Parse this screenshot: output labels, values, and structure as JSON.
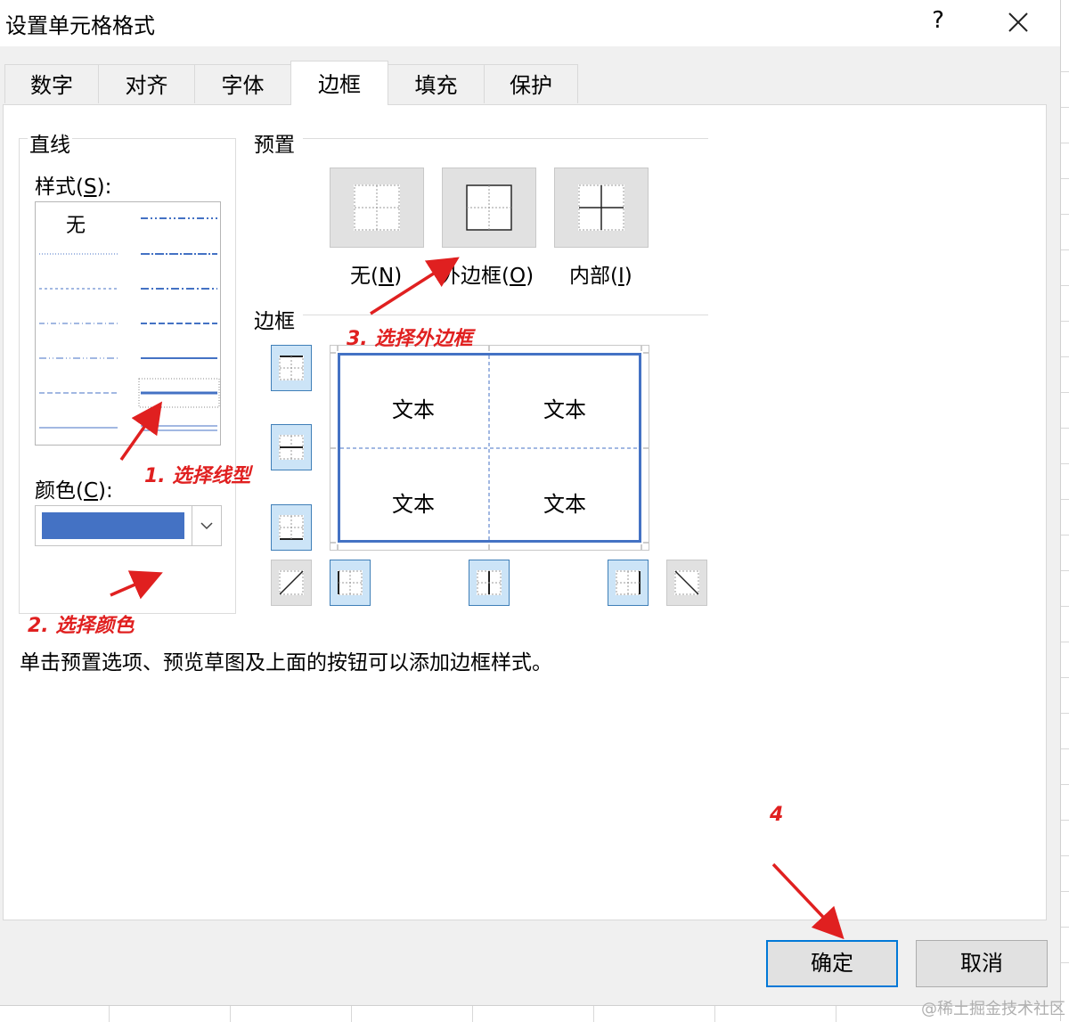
{
  "window": {
    "title": "设置单元格格式",
    "help_label": "?"
  },
  "tabs": [
    {
      "label": "数字"
    },
    {
      "label": "对齐"
    },
    {
      "label": "字体"
    },
    {
      "label": "边框",
      "active": true
    },
    {
      "label": "填充"
    },
    {
      "label": "保护"
    }
  ],
  "line_group": {
    "title": "直线",
    "style_label": "样式(",
    "style_key": "S",
    "style_suffix": "):",
    "none_option": "无",
    "color_label": "颜色(",
    "color_key": "C",
    "color_suffix": "):",
    "selected_color": "#4472c4"
  },
  "presets": {
    "title": "预置",
    "items": [
      {
        "label": "无(",
        "key": "N",
        "suffix": ")"
      },
      {
        "label": "外边框(",
        "key": "O",
        "suffix": ")"
      },
      {
        "label": "内部(",
        "key": "I",
        "suffix": ")"
      }
    ]
  },
  "border": {
    "title": "边框",
    "cells": [
      "文本",
      "文本",
      "文本",
      "文本"
    ]
  },
  "hint": "单击预置选项、预览草图及上面的按钮可以添加边框样式。",
  "annotations": {
    "step1": "1. 选择线型",
    "step2": "2. 选择颜色",
    "step3": "3. 选择外边框",
    "step4": "4"
  },
  "buttons": {
    "ok": "确定",
    "cancel": "取消"
  },
  "watermark": "@稀土掘金技术社区",
  "colors": {
    "accent": "#4472c4",
    "annotation": "#e02020",
    "focus": "#0078d7"
  }
}
